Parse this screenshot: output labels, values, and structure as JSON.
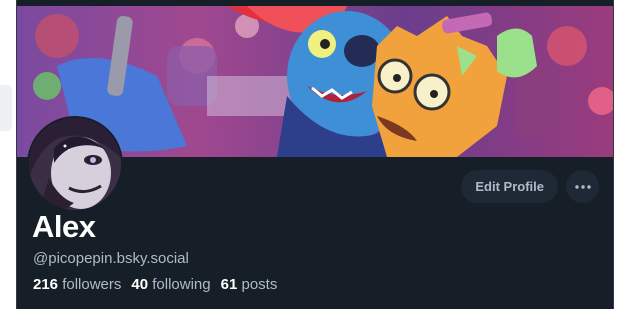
{
  "profile": {
    "display_name": "Alex",
    "handle": "@picopepin.bsky.social",
    "edit_label": "Edit Profile",
    "more_icon": "ellipsis-icon",
    "stats": {
      "followers_count": "216",
      "followers_label": "followers",
      "following_count": "40",
      "following_label": "following",
      "posts_count": "61",
      "posts_label": "posts"
    }
  },
  "colors": {
    "card_bg": "#161e27",
    "button_bg": "#1e2935",
    "text_primary": "#ffffff",
    "text_secondary": "#aebbc9"
  }
}
